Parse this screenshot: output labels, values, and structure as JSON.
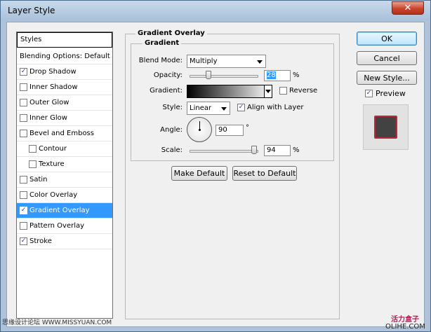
{
  "window": {
    "title": "Layer Style",
    "close_glyph": "✕"
  },
  "styles_list": {
    "header": "Styles",
    "items": [
      {
        "label": "Blending Options: Default",
        "checkbox": false,
        "checked": false,
        "indent": false,
        "selected": false
      },
      {
        "label": "Drop Shadow",
        "checkbox": true,
        "checked": true,
        "indent": false,
        "selected": false
      },
      {
        "label": "Inner Shadow",
        "checkbox": true,
        "checked": false,
        "indent": false,
        "selected": false
      },
      {
        "label": "Outer Glow",
        "checkbox": true,
        "checked": false,
        "indent": false,
        "selected": false
      },
      {
        "label": "Inner Glow",
        "checkbox": true,
        "checked": false,
        "indent": false,
        "selected": false
      },
      {
        "label": "Bevel and Emboss",
        "checkbox": true,
        "checked": false,
        "indent": false,
        "selected": false
      },
      {
        "label": "Contour",
        "checkbox": true,
        "checked": false,
        "indent": true,
        "selected": false
      },
      {
        "label": "Texture",
        "checkbox": true,
        "checked": false,
        "indent": true,
        "selected": false
      },
      {
        "label": "Satin",
        "checkbox": true,
        "checked": false,
        "indent": false,
        "selected": false
      },
      {
        "label": "Color Overlay",
        "checkbox": true,
        "checked": false,
        "indent": false,
        "selected": false
      },
      {
        "label": "Gradient Overlay",
        "checkbox": true,
        "checked": true,
        "indent": false,
        "selected": true
      },
      {
        "label": "Pattern Overlay",
        "checkbox": true,
        "checked": false,
        "indent": false,
        "selected": false
      },
      {
        "label": "Stroke",
        "checkbox": true,
        "checked": true,
        "indent": false,
        "selected": false
      }
    ]
  },
  "gradient_overlay": {
    "group_title": "Gradient Overlay",
    "subgroup_title": "Gradient",
    "blend_mode_label": "Blend Mode:",
    "blend_mode_value": "Multiply",
    "opacity_label": "Opacity:",
    "opacity_value": "28",
    "opacity_percent": 28,
    "gradient_label": "Gradient:",
    "gradient_colors": [
      "#000000",
      "#ffffff"
    ],
    "reverse_label": "Reverse",
    "reverse_checked": false,
    "style_label": "Style:",
    "style_value": "Linear",
    "align_label": "Align with Layer",
    "align_checked": true,
    "angle_label": "Angle:",
    "angle_value": "90",
    "angle_unit": "°",
    "scale_label": "Scale:",
    "scale_value": "94",
    "scale_percent": 94,
    "percent_unit": "%",
    "make_default_label": "Make Default",
    "reset_default_label": "Reset to Default"
  },
  "actions": {
    "ok_label": "OK",
    "cancel_label": "Cancel",
    "new_style_label": "New Style...",
    "preview_label": "Preview",
    "preview_checked": true
  },
  "watermarks": {
    "left": "思缘设计论坛 WWW.MISSYUAN.COM",
    "right_top": "活力盒子",
    "right_bottom": "OLIHE.COM"
  },
  "colors": {
    "selection": "#3399ff",
    "preview_swatch": "#424242",
    "preview_stroke": "#b8293b"
  },
  "checkmark": "✓"
}
